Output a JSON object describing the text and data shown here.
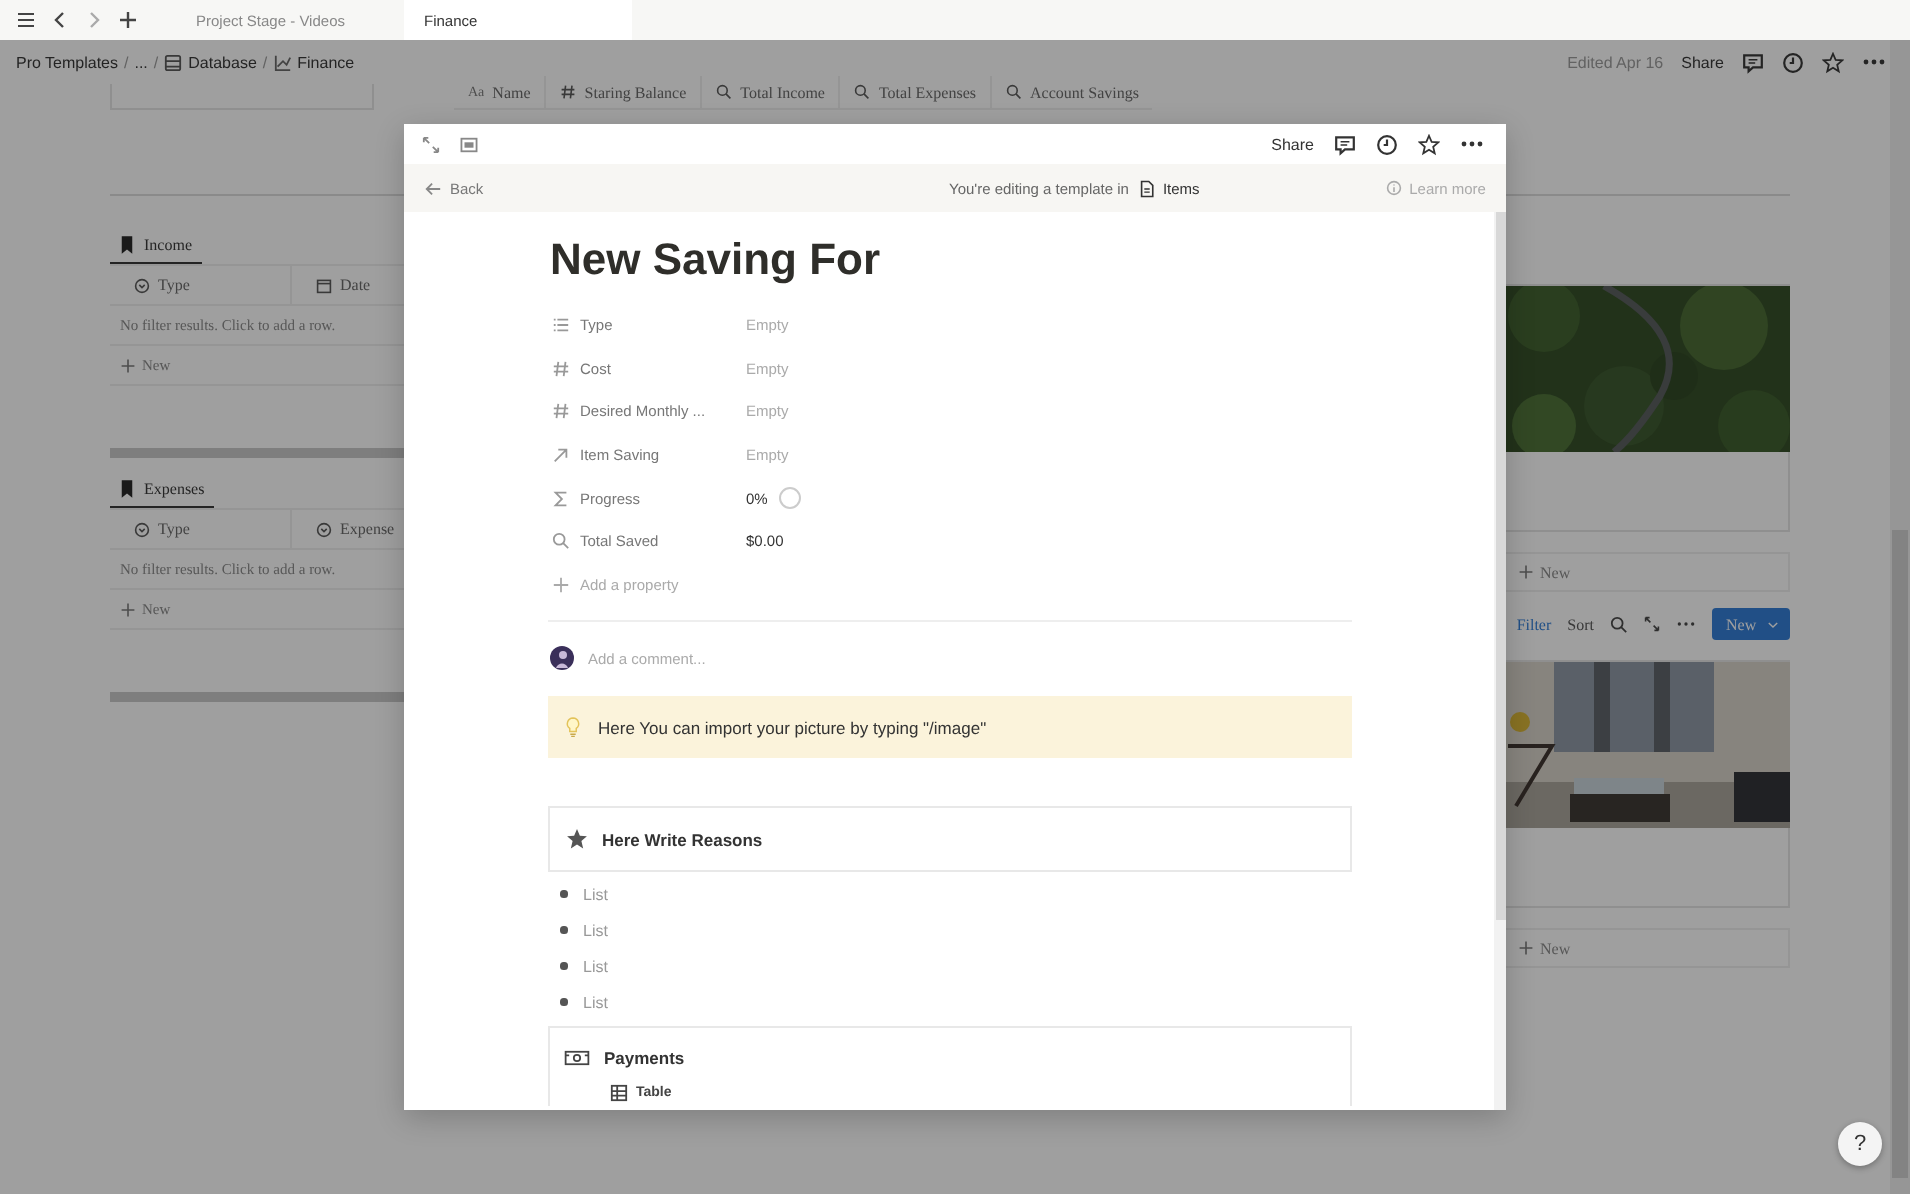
{
  "tab_bar": {
    "tabs": [
      {
        "label": "Project Stage - Videos",
        "selected": false
      },
      {
        "label": "Finance",
        "selected": true
      }
    ]
  },
  "breadcrumb": [
    {
      "label": "Pro Templates",
      "kind": "text"
    },
    {
      "label": "/",
      "kind": "sep"
    },
    {
      "label": "...",
      "kind": "text"
    },
    {
      "label": "/",
      "kind": "sep"
    },
    {
      "label": "Database",
      "kind": "database"
    },
    {
      "label": "/",
      "kind": "sep"
    },
    {
      "label": "Finance",
      "kind": "chart"
    }
  ],
  "topbar": {
    "edited": "Edited Apr 16",
    "share": "Share"
  },
  "table_header": {
    "columns": [
      {
        "label": "Name",
        "kind": "title",
        "prefix": "Aa"
      },
      {
        "label": "Staring Balance",
        "kind": "number"
      },
      {
        "label": "Total Income",
        "kind": "rollup"
      },
      {
        "label": "Total Expenses",
        "kind": "rollup"
      },
      {
        "label": "Account Savings",
        "kind": "rollup"
      }
    ]
  },
  "sections": [
    {
      "title": "Income",
      "columns": [
        {
          "label": "Type",
          "kind": "select"
        },
        {
          "label": "Date",
          "kind": "date"
        }
      ],
      "empty": "No filter results. Click to add a row.",
      "new": "New"
    },
    {
      "title": "Expenses",
      "columns": [
        {
          "label": "Type",
          "kind": "select"
        },
        {
          "label": "Expense",
          "kind": "select"
        }
      ],
      "empty": "No filter results. Click to add a row.",
      "new": "New"
    }
  ],
  "galleries": [
    {
      "new": "New"
    },
    {
      "new": "New"
    }
  ],
  "gallery_toolbar": {
    "filter": "Filter",
    "sort": "Sort",
    "new": "New"
  },
  "modal": {
    "share": "Share",
    "banner": {
      "back": "Back",
      "text": "You're editing a template in",
      "template": "Items",
      "learn": "Learn more"
    },
    "title": "New Saving For",
    "properties": [
      {
        "label": "Type",
        "kind": "select",
        "value": "Empty",
        "empty": true
      },
      {
        "label": "Cost",
        "kind": "number",
        "value": "Empty",
        "empty": true
      },
      {
        "label": "Desired Monthly ...",
        "kind": "number",
        "value": "Empty",
        "empty": true
      },
      {
        "label": "Item Saving",
        "kind": "relation",
        "value": "Empty",
        "empty": true
      },
      {
        "label": "Progress",
        "kind": "formula",
        "value": "0%",
        "empty": false,
        "level": 0
      },
      {
        "label": "Total Saved",
        "kind": "rollup",
        "value": "$0.00",
        "empty": false
      }
    ],
    "add_property": "Add a property",
    "comment": {
      "placeholder": "Add a comment..."
    },
    "callout": "Here You can import your picture by typing \"/image\"",
    "toggle_heading": "Here Write Reasons",
    "list": [
      {
        "placeholder": "List"
      },
      {
        "placeholder": "List"
      },
      {
        "placeholder": "List"
      },
      {
        "placeholder": "List"
      }
    ],
    "payments": {
      "title": "Payments",
      "view": "Table"
    }
  },
  "help": "?"
}
